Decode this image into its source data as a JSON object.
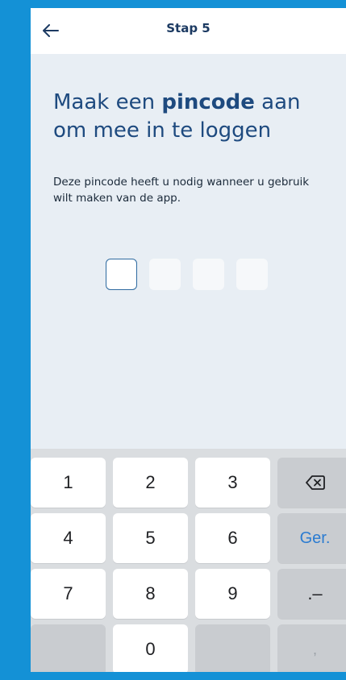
{
  "header": {
    "title": "Stap 5",
    "back_icon": "arrow-left-icon"
  },
  "main": {
    "heading_part1": "Maak een ",
    "heading_bold": "pincode",
    "heading_part2": " aan om mee in te loggen",
    "description": "Deze pincode heeft u nodig wanneer u gebruik wilt maken van de app."
  },
  "pin": {
    "length": 4,
    "active_index": 0
  },
  "keyboard": {
    "k1": "1",
    "k2": "2",
    "k3": "3",
    "k4": "4",
    "k5": "5",
    "k6": "6",
    "k7": "7",
    "k8": "8",
    "k9": "9",
    "k0": "0",
    "go_label": "Ger.",
    "dot_dash": ".–",
    "comma": ",",
    "backspace_icon": "backspace-icon"
  },
  "colors": {
    "brand_blue": "#1491d6",
    "heading": "#1e4a7f",
    "keyboard_bg": "#dadde0",
    "go_label": "#2a7bd1"
  }
}
